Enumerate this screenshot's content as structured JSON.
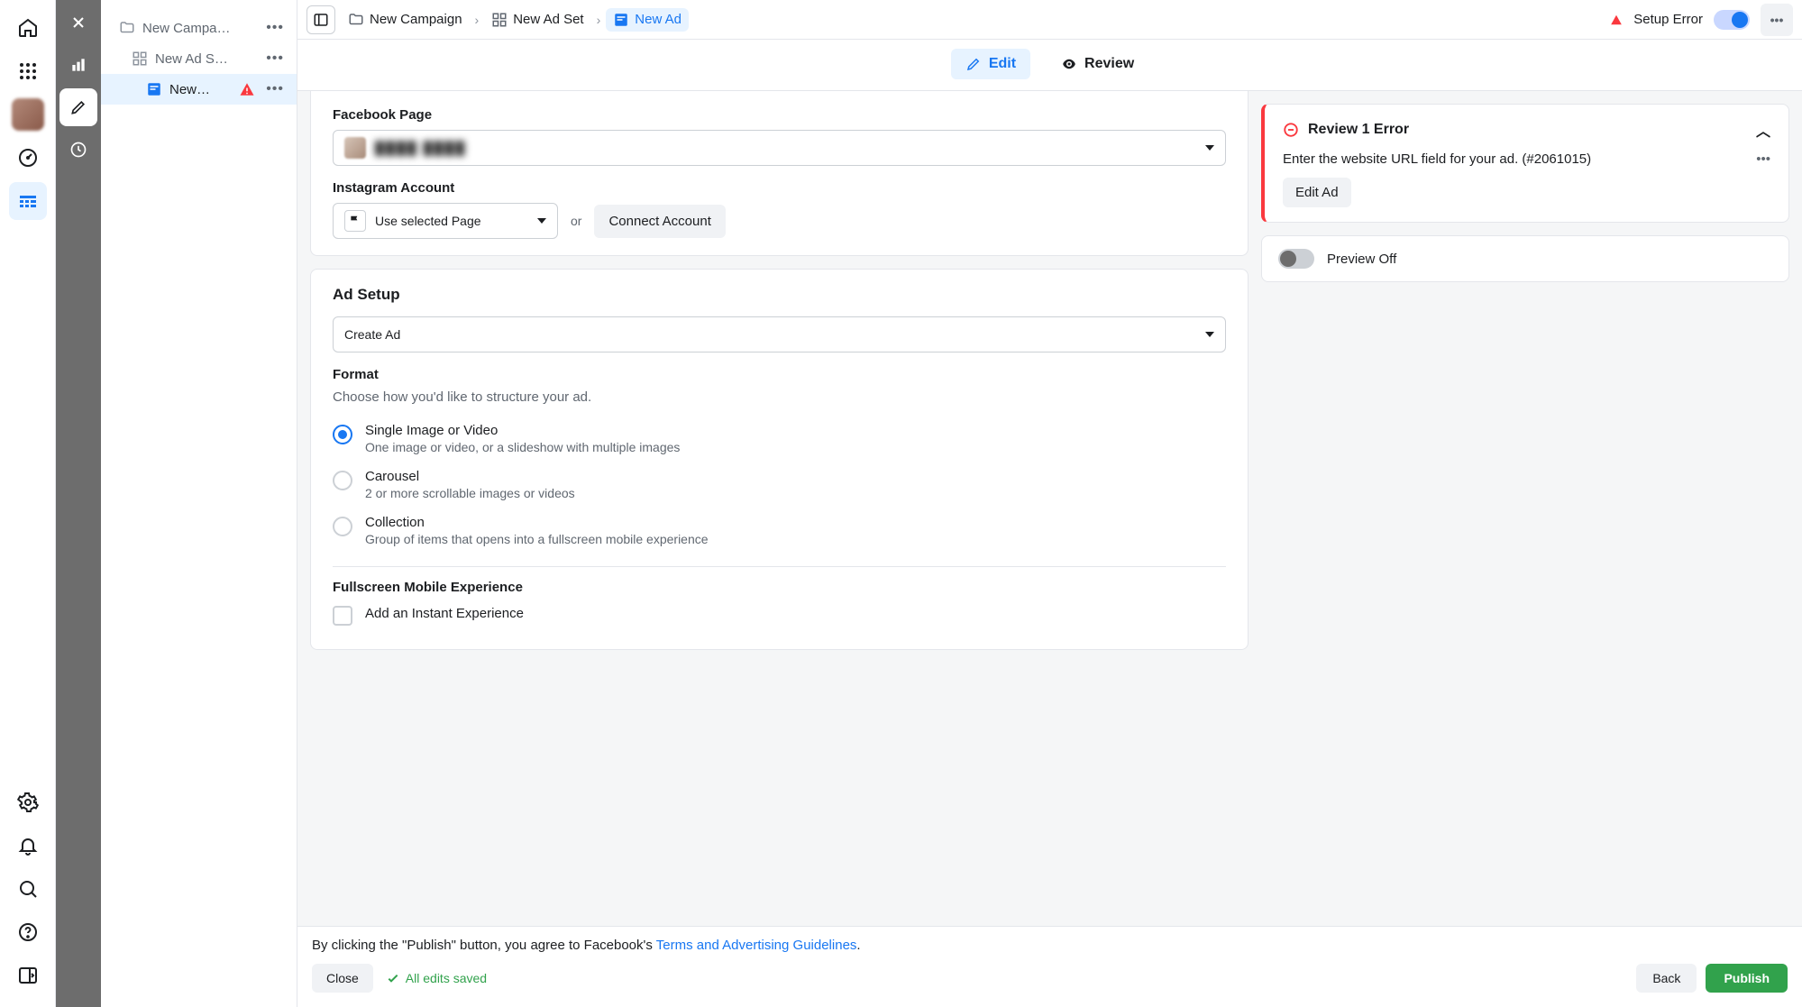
{
  "breadcrumbs": {
    "campaign": "New Campaign",
    "adset": "New Ad Set",
    "ad": "New Ad"
  },
  "header": {
    "setup_error": "Setup Error"
  },
  "subtabs": {
    "edit": "Edit",
    "review": "Review"
  },
  "tree": {
    "campaign": "New Campa…",
    "adset": "New Ad S…",
    "ad": "New…"
  },
  "identity": {
    "fb_page_label": "Facebook Page",
    "ig_label": "Instagram Account",
    "ig_select": "Use selected Page",
    "or": "or",
    "connect": "Connect Account"
  },
  "adsetup": {
    "title": "Ad Setup",
    "create": "Create Ad",
    "format_label": "Format",
    "format_sub": "Choose how you'd like to structure your ad.",
    "opt1_t": "Single Image or Video",
    "opt1_s": "One image or video, or a slideshow with multiple images",
    "opt2_t": "Carousel",
    "opt2_s": "2 or more scrollable images or videos",
    "opt3_t": "Collection",
    "opt3_s": "Group of items that opens into a fullscreen mobile experience",
    "fullscreen_label": "Fullscreen Mobile Experience",
    "instant": "Add an Instant Experience"
  },
  "review_panel": {
    "title": "Review 1 Error",
    "msg": "Enter the website URL field for your ad. (#2061015)",
    "edit_ad": "Edit Ad"
  },
  "preview": {
    "label": "Preview Off"
  },
  "footer": {
    "line_a": "By clicking the \"Publish\" button, you agree to Facebook's ",
    "line_link": "Terms and Advertising Guidelines",
    "close": "Close",
    "saved": "All edits saved",
    "back": "Back",
    "publish": "Publish"
  }
}
